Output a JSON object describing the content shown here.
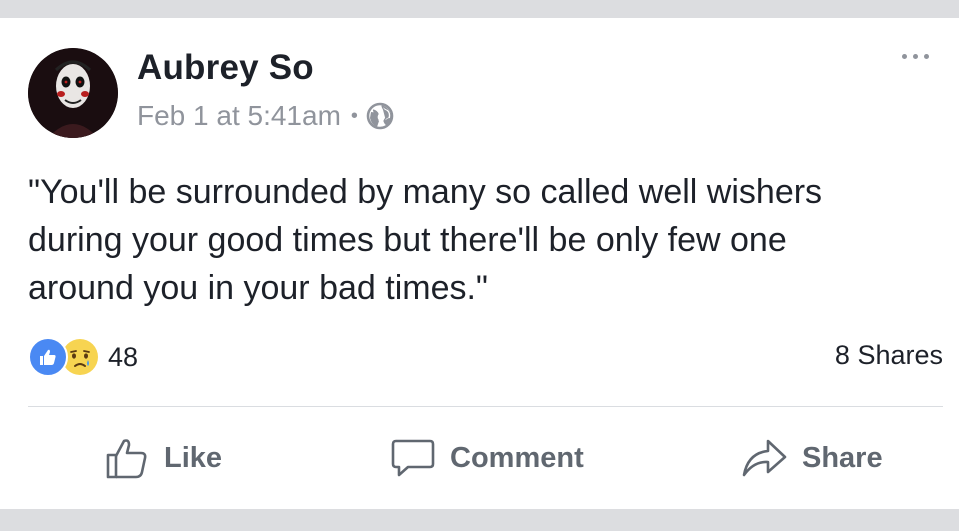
{
  "post": {
    "author": "Aubrey So",
    "timestamp": "Feb 1 at 5:41am",
    "separator": "•",
    "privacy_icon": "globe-icon",
    "text_lines": [
      "\"You'll be surrounded by many so called well wishers",
      "during your good times but there'll be only few one",
      "around you in your bad times.\""
    ]
  },
  "stats": {
    "reaction_icons": [
      "like-reaction-icon",
      "sad-reaction-icon"
    ],
    "reaction_count": "48",
    "shares": "8 Shares"
  },
  "actions": {
    "like_label": "Like",
    "comment_label": "Comment",
    "share_label": "Share"
  },
  "colors": {
    "name": "#1d2129",
    "meta": "#90949c",
    "action": "#606770",
    "like_blue": "#4a89f3",
    "sad_yellow": "#f7d451",
    "background": "#dcdde0"
  }
}
